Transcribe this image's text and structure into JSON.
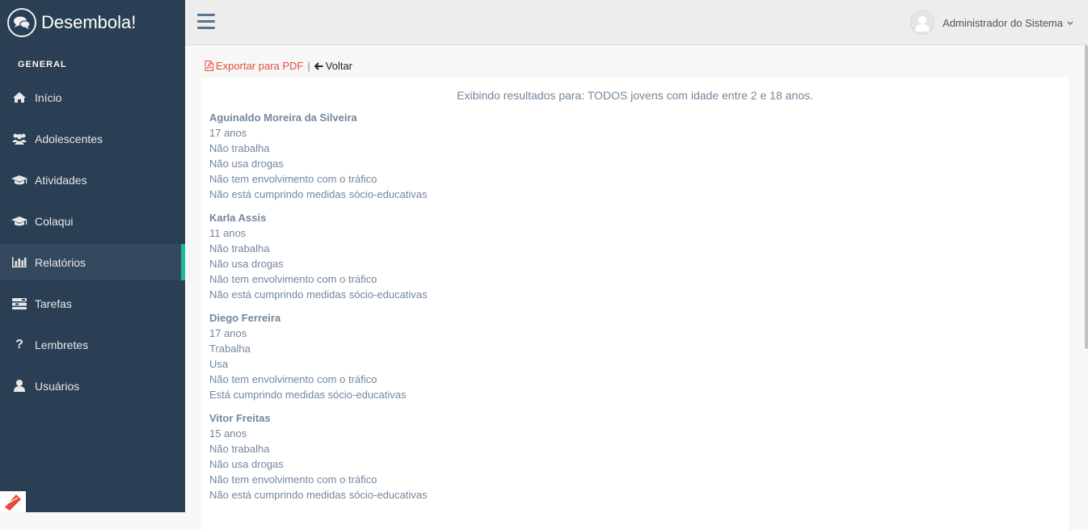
{
  "app": {
    "title": "Desembola!"
  },
  "sidebar": {
    "section_title": "GENERAL",
    "items": [
      {
        "label": "Início",
        "icon": "home-icon"
      },
      {
        "label": "Adolescentes",
        "icon": "users-icon"
      },
      {
        "label": "Atividades",
        "icon": "graduation-cap-icon"
      },
      {
        "label": "Colaqui",
        "icon": "graduation-cap-icon"
      },
      {
        "label": "Relatórios",
        "icon": "bar-chart-icon",
        "active": true
      },
      {
        "label": "Tarefas",
        "icon": "tasks-icon"
      },
      {
        "label": "Lembretes",
        "icon": "question-icon"
      },
      {
        "label": "Usuários",
        "icon": "user-icon"
      }
    ]
  },
  "topbar": {
    "user_name": "Administrador do Sistema"
  },
  "actions": {
    "pdf_label": "Exportar para PDF",
    "separator": "|",
    "back_label": "Voltar"
  },
  "report": {
    "header": "Exibindo resultados para: TODOS jovens com idade entre 2 e 18 anos.",
    "people": [
      {
        "name": "Aguinaldo Moreira da Silveira",
        "age": "17 anos",
        "work": "Não trabalha",
        "drugs": "Não usa drogas",
        "traffic": "Não tem envolvimento com o tráfico",
        "measures": "Não está cumprindo medidas sócio-educativas"
      },
      {
        "name": "Karla Assis",
        "age": "11 anos",
        "work": "Não trabalha",
        "drugs": "Não usa drogas",
        "traffic": "Não tem envolvimento com o tráfico",
        "measures": "Não está cumprindo medidas sócio-educativas"
      },
      {
        "name": "Diego Ferreira",
        "age": "17 anos",
        "work": "Trabalha",
        "drugs": "Usa",
        "traffic": "Não tem envolvimento com o tráfico",
        "measures": "Está cumprindo medidas sócio-educativas"
      },
      {
        "name": "Vitor Freitas",
        "age": "15 anos",
        "work": "Não trabalha",
        "drugs": "Não usa drogas",
        "traffic": "Não tem envolvimento com o tráfico",
        "measures": "Não está cumprindo medidas sócio-educativas"
      }
    ]
  },
  "colors": {
    "sidebar_bg": "#2a3f54",
    "active_border": "#1abb9c",
    "pdf_red": "#e74c3c",
    "text_muted": "#73879c"
  }
}
